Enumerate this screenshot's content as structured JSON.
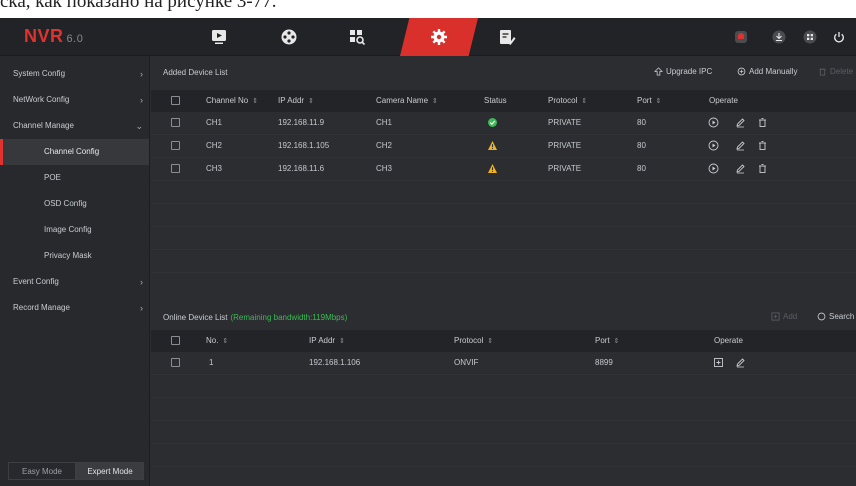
{
  "caption": "ска, как показано на рисунке 3-77.",
  "app": {
    "logo": "NVR",
    "version": "6.0"
  },
  "top_nav": [
    "live-view-icon",
    "playback-icon",
    "search-icon",
    "settings-icon",
    "maintenance-icon"
  ],
  "top_right_icons": [
    "alarm-icon",
    "download-icon",
    "grid-icon",
    "power-icon"
  ],
  "sidebar": {
    "items": [
      {
        "label": "System Config",
        "chevron": "›"
      },
      {
        "label": "NetWork Config",
        "chevron": "›"
      },
      {
        "label": "Channel Manage",
        "chevron": "⌄"
      },
      {
        "label": "Channel Config",
        "sub": true,
        "active": true
      },
      {
        "label": "POE",
        "sub": true
      },
      {
        "label": "OSD Config",
        "sub": true
      },
      {
        "label": "Image Config",
        "sub": true
      },
      {
        "label": "Privacy Mask",
        "sub": true
      },
      {
        "label": "Event Config",
        "chevron": "›"
      },
      {
        "label": "Record Manage",
        "chevron": "›"
      }
    ],
    "modes": {
      "easy": "Easy Mode",
      "expert": "Expert Mode"
    }
  },
  "added": {
    "title": "Added Device List",
    "upgrade": "Upgrade IPC",
    "add_manually": "Add Manually",
    "delete": "Delete",
    "headers": {
      "channel": "Channel No",
      "ip": "IP Addr",
      "camera": "Camera Name",
      "status": "Status",
      "protocol": "Protocol",
      "port": "Port",
      "operate": "Operate"
    },
    "rows": [
      {
        "channel": "CH1",
        "ip": "192.168.11.9",
        "camera": "CH1",
        "status": "ok",
        "protocol": "PRIVATE",
        "port": "80"
      },
      {
        "channel": "CH2",
        "ip": "192.168.1.105",
        "camera": "CH2",
        "status": "warn",
        "protocol": "PRIVATE",
        "port": "80"
      },
      {
        "channel": "CH3",
        "ip": "192.168.11.6",
        "camera": "CH3",
        "status": "warn",
        "protocol": "PRIVATE",
        "port": "80"
      }
    ]
  },
  "online": {
    "title": "Online Device List",
    "bandwidth": "(Remaining bandwidth:119Mbps)",
    "add": "Add",
    "search": "Search",
    "headers": {
      "no": "No.",
      "ip": "IP Addr",
      "protocol": "Protocol",
      "port": "Port",
      "operate": "Operate"
    },
    "rows": [
      {
        "no": "1",
        "ip": "192.168.1.106",
        "protocol": "ONVIF",
        "port": "8899"
      }
    ]
  },
  "colors": {
    "accent": "#e0332f",
    "ok": "#3cba54",
    "warn": "#f2b21b",
    "bandwidth": "#3cba54"
  }
}
